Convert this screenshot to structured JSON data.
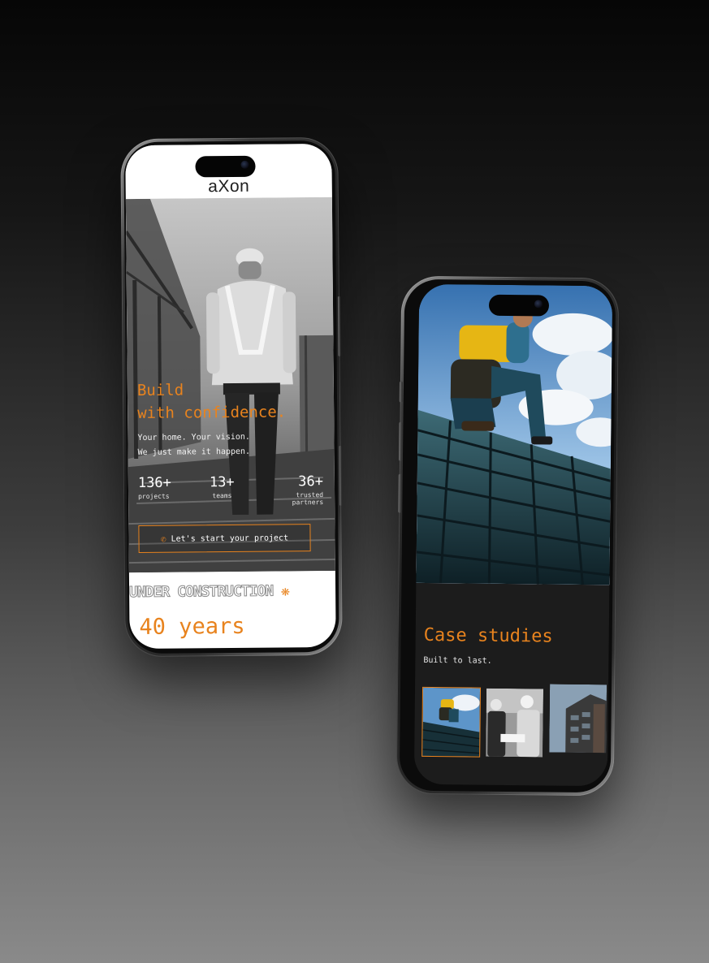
{
  "phone1": {
    "logo": "aXon",
    "hero": {
      "title_line1": "Build",
      "title_line2": "with confidence.",
      "subtitle_line1": "Your home. Your vision.",
      "subtitle_line2": "We just make it happen."
    },
    "stats": [
      {
        "value": "136+",
        "label": "projects"
      },
      {
        "value": "13+",
        "label": "teams"
      },
      {
        "value": "36+",
        "label_line1": "trusted",
        "label_line2": "partners"
      }
    ],
    "cta": {
      "icon": "phone-icon",
      "label": "Let's start your project"
    },
    "marquee": {
      "text": "UNDER CONSTRUCTION",
      "icon": "asterisk-icon"
    },
    "years_text": "40 years"
  },
  "phone2": {
    "section_title": "Case studies",
    "section_subtitle": "Built to last.",
    "thumbnails": [
      "roofer-thumbnail",
      "engineers-thumbnail",
      "building-thumbnail"
    ]
  },
  "colors": {
    "accent": "#e8831e",
    "dark_screen": "#1c1c1c",
    "light_screen": "#ffffff"
  }
}
